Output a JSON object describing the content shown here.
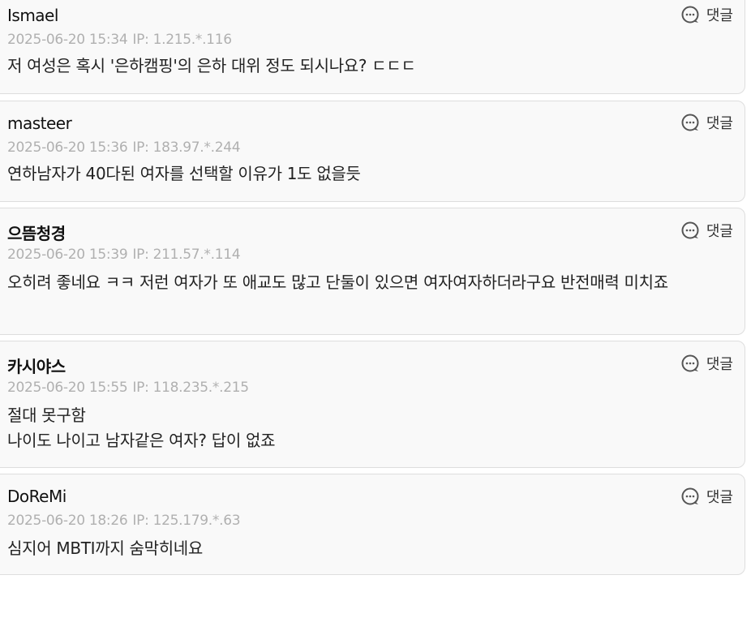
{
  "comments": [
    {
      "author": "Ismael",
      "date": "2025-06-20 15:34",
      "ip": "IP: 1.215.*.116",
      "lines": [
        "저 여성은 혹시 '은하캠핑'의 은하 대위 정도 되시나요? ㄷㄷㄷ"
      ],
      "reply_label": "댓글"
    },
    {
      "author": "masteer",
      "date": "2025-06-20 15:36",
      "ip": "IP: 183.97.*.244",
      "lines": [
        "연하남자가 40다된 여자를 선택할 이유가 1도 없을듯"
      ],
      "reply_label": "댓글"
    },
    {
      "author": "으뜸청경",
      "date": "2025-06-20 15:39",
      "ip": "IP: 211.57.*.114",
      "lines": [
        "오히려 좋네요 ㅋㅋ 저런 여자가 또 애교도 많고 단둘이 있으면 여자여자하더라구요 반전매력 미치죠"
      ],
      "reply_label": "댓글"
    },
    {
      "author": "카시야스",
      "date": "2025-06-20 15:55",
      "ip": "IP: 118.235.*.215",
      "lines": [
        "절대 못구함",
        "나이도 나이고 남자같은 여자? 답이 없죠"
      ],
      "reply_label": "댓글"
    },
    {
      "author": "DoReMi",
      "date": "2025-06-20 18:26",
      "ip": "IP: 125.179.*.63",
      "lines": [
        "심지어 MBTI까지 숨막히네요"
      ],
      "reply_label": "댓글"
    }
  ]
}
